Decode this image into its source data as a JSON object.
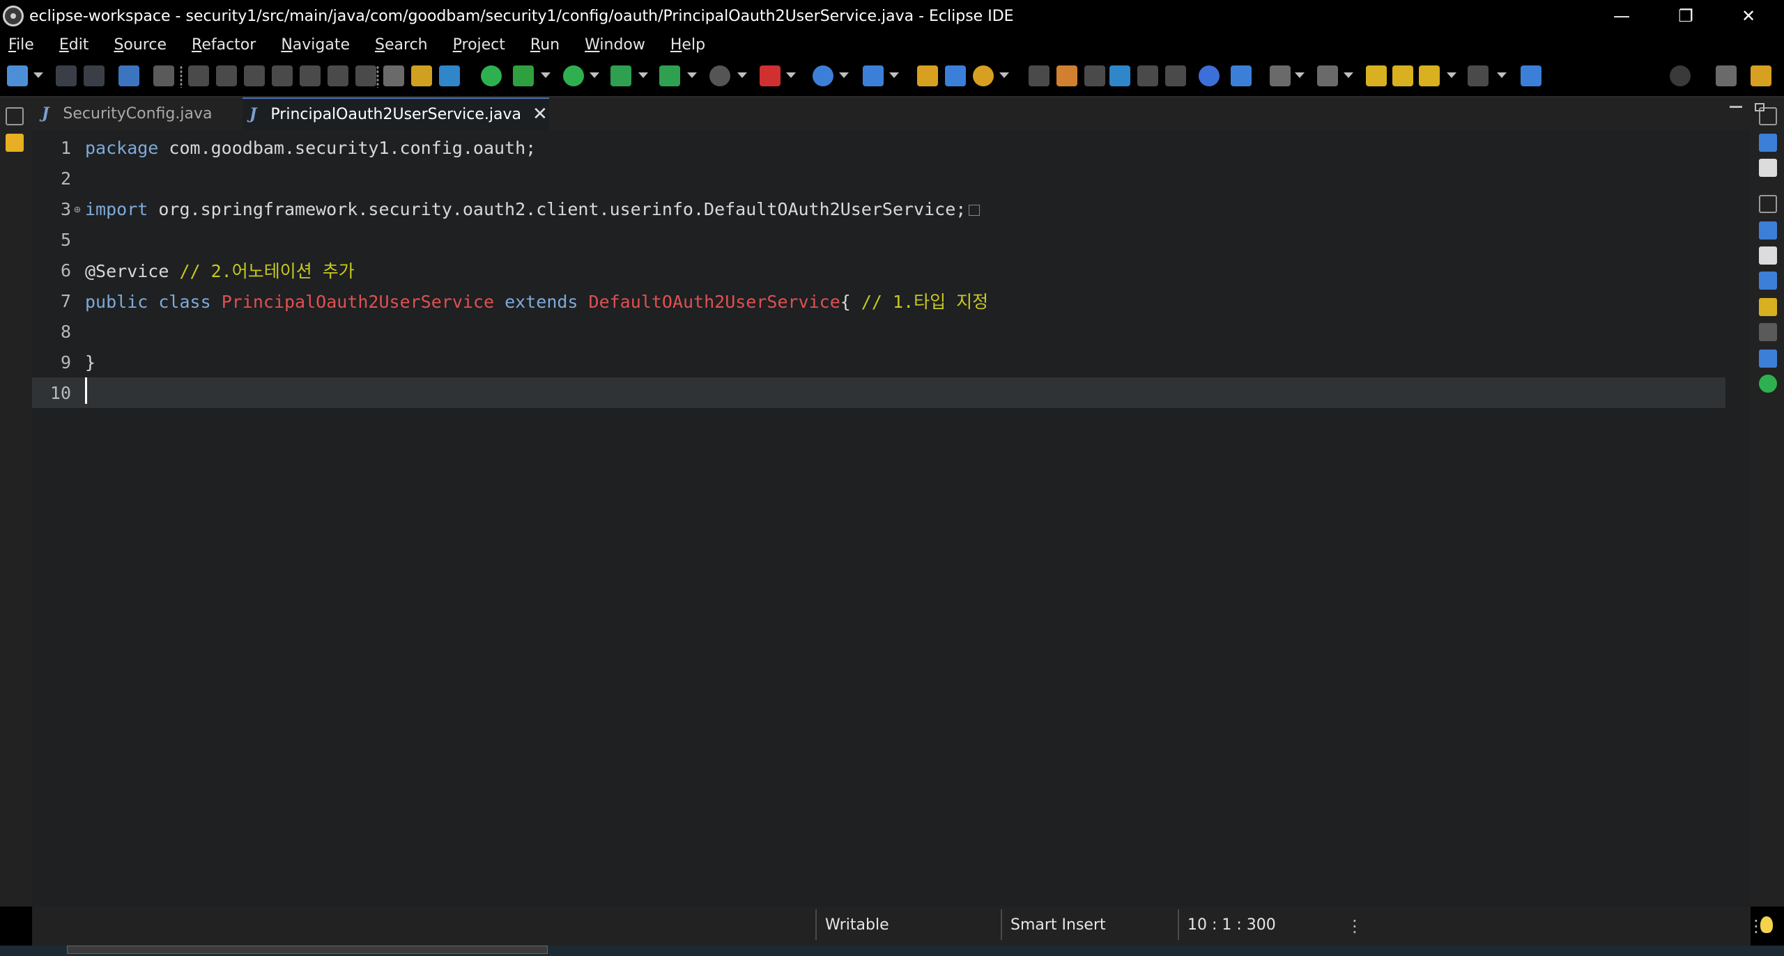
{
  "window": {
    "title": "eclipse-workspace - security1/src/main/java/com/goodbam/security1/config/oauth/PrincipalOauth2UserService.java - Eclipse IDE",
    "controls": {
      "minimize": "—",
      "restore": "❐",
      "close": "✕"
    }
  },
  "menu": [
    "File",
    "Edit",
    "Source",
    "Refactor",
    "Navigate",
    "Search",
    "Project",
    "Run",
    "Window",
    "Help"
  ],
  "tabs": [
    {
      "label": "SecurityConfig.java",
      "active": false
    },
    {
      "label": "PrincipalOauth2UserService.java",
      "active": true
    }
  ],
  "editor": {
    "lines": [
      {
        "num": "1",
        "tokens": [
          {
            "t": "package",
            "c": "kw"
          },
          {
            "t": " com.goodbam.security1.config.oauth;",
            "c": "pl"
          }
        ]
      },
      {
        "num": "2",
        "tokens": []
      },
      {
        "num": "3",
        "fold": "⊕",
        "collapsed": true,
        "tokens": [
          {
            "t": "import",
            "c": "kw"
          },
          {
            "t": " org.springframework.security.oauth2.client.userinfo.DefaultOAuth2UserService;",
            "c": "pl"
          }
        ]
      },
      {
        "num": "5",
        "tokens": []
      },
      {
        "num": "6",
        "tokens": [
          {
            "t": "@Service",
            "c": "an"
          },
          {
            "t": " // 2.어노테이션 추가",
            "c": "cm"
          }
        ]
      },
      {
        "num": "7",
        "tokens": [
          {
            "t": "public",
            "c": "kw"
          },
          {
            "t": " ",
            "c": "pl"
          },
          {
            "t": "class",
            "c": "kw"
          },
          {
            "t": " ",
            "c": "pl"
          },
          {
            "t": "PrincipalOauth2UserService",
            "c": "cls"
          },
          {
            "t": " ",
            "c": "pl"
          },
          {
            "t": "extends",
            "c": "kw"
          },
          {
            "t": " ",
            "c": "pl"
          },
          {
            "t": "DefaultOAuth2UserService",
            "c": "cls"
          },
          {
            "t": "{ ",
            "c": "pl"
          },
          {
            "t": "// 1.타입 지정",
            "c": "cm"
          }
        ]
      },
      {
        "num": "8",
        "tokens": []
      },
      {
        "num": "9",
        "tokens": [
          {
            "t": "}",
            "c": "pl"
          }
        ]
      },
      {
        "num": "10",
        "current": true,
        "tokens": []
      }
    ]
  },
  "status": {
    "mode": "Writable",
    "insert": "Smart Insert",
    "position": "10 : 1 : 300"
  },
  "colors": {
    "keyword": "#7eaad8",
    "class_name": "#e05050",
    "comment": "#c8c820",
    "editor_bg": "#1e2022",
    "current_line": "#2f3336"
  }
}
